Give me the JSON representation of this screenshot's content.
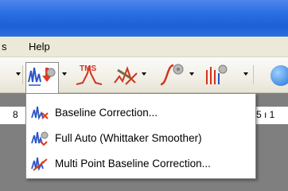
{
  "menubar": {
    "items": [
      "s",
      "Help"
    ]
  },
  "toolbar": {
    "tms_label": "TMS",
    "buttons": [
      "baseline-dropdown",
      "tms-tool",
      "peak-pick-tool",
      "integration-tool",
      "multiplet-tool"
    ]
  },
  "ruler": {
    "left": "8",
    "right": "5 ı 1"
  },
  "dropdown": {
    "items": [
      {
        "label": "Baseline Correction...",
        "icon": "baseline-correction-icon"
      },
      {
        "label": "Full Auto (Whittaker Smoother)",
        "icon": "auto-baseline-icon"
      },
      {
        "label": "Multi Point Baseline Correction...",
        "icon": "multipoint-baseline-icon"
      }
    ]
  }
}
